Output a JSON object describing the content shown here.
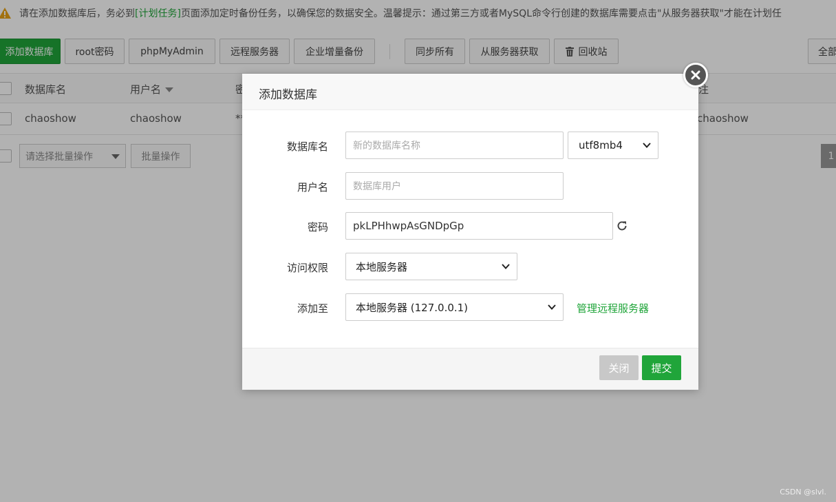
{
  "notice": {
    "text_before": "请在添加数据库后，务必到",
    "link_text": "[计划任务]",
    "text_after": "页面添加定时备份任务，以确保您的数据安全。温馨提示：通过第三方或者MySQL命令行创建的数据库需要点击\"从服务器获取\"才能在计划任"
  },
  "toolbar": {
    "add_db": "添加数据库",
    "root_pwd": "root密码",
    "phpmyadmin": "phpMyAdmin",
    "remote_server": "远程服务器",
    "incr_backup": "企业增量备份",
    "sync_all": "同步所有",
    "fetch_from_server": "从服务器获取",
    "recycle_bin": "回收站",
    "all": "全部"
  },
  "table": {
    "headers": {
      "db_name": "数据库名",
      "username": "用户名",
      "password": "密",
      "note": "备注"
    },
    "rows": [
      {
        "db_name": "chaoshow",
        "username": "chaoshow",
        "password": "**",
        "note": "chaoshow"
      }
    ]
  },
  "batch": {
    "select_placeholder": "请选择批量操作",
    "button": "批量操作",
    "page": "1"
  },
  "modal": {
    "title": "添加数据库",
    "fields": {
      "db_name_label": "数据库名",
      "db_name_placeholder": "新的数据库名称",
      "charset": "utf8mb4",
      "username_label": "用户名",
      "username_placeholder": "数据库用户",
      "password_label": "密码",
      "password_value": "pkLPHhwpAsGNDpGp",
      "access_label": "访问权限",
      "access_value": "本地服务器",
      "add_to_label": "添加至",
      "add_to_value": "本地服务器 (127.0.0.1)",
      "manage_remote": "管理远程服务器"
    },
    "close_label": "关闭",
    "submit_label": "提交"
  },
  "watermark": "CSDN @slvl.",
  "colors": {
    "accent": "#20a53a",
    "overlay": "rgba(0,0,0,0.30)"
  }
}
